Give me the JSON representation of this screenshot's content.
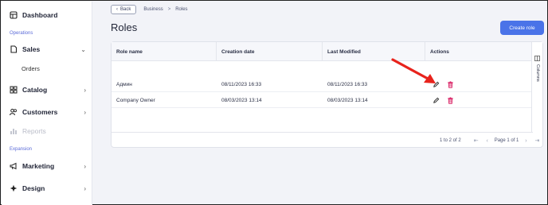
{
  "sidebar": {
    "dashboard": "Dashboard",
    "section_operations": "Operations",
    "sales": "Sales",
    "orders": "Orders",
    "catalog": "Catalog",
    "customers": "Customers",
    "reports": "Reports",
    "section_expansion": "Expansion",
    "marketing": "Marketing",
    "design": "Design"
  },
  "breadcrumb": {
    "back": "Back",
    "business": "Business",
    "separator": ">",
    "current": "Roles"
  },
  "page": {
    "title": "Roles",
    "create_button": "Create role"
  },
  "table": {
    "columns": [
      "Role name",
      "Creation date",
      "Last Modified",
      "Actions"
    ],
    "rows": [
      [
        "Админ",
        "08/11/2023 16:33",
        "08/11/2023 16:33"
      ],
      [
        "Company Owner",
        "08/03/2023 13:14",
        "08/03/2023 13:14"
      ]
    ],
    "columns_tab": "Columns"
  },
  "pagination": {
    "range": "1 to 2 of 2",
    "page": "Page 1 of 1"
  },
  "colors": {
    "accent": "#4a73e8",
    "delete": "#d81b60",
    "arrow": "#e8231c",
    "section_label": "#5b6bd8"
  }
}
